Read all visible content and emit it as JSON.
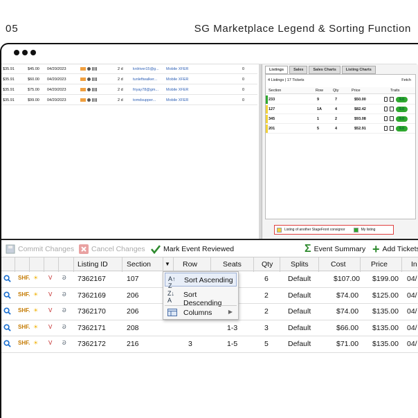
{
  "page": {
    "number": "05",
    "title": "SG Marketplace Legend & Sorting Function"
  },
  "left_rows": [
    {
      "cost": "$35.91",
      "price": "$45.00",
      "date": "04/20/2023",
      "days": "2 d",
      "email": "krdriver15@g...",
      "delivery": "Mobile XFER",
      "count": "0"
    },
    {
      "cost": "$35.91",
      "price": "$60.00",
      "date": "04/20/2023",
      "days": "2 d",
      "email": "tunleftwalker...",
      "delivery": "Mobile XFER",
      "count": "0"
    },
    {
      "cost": "$35.91",
      "price": "$75.00",
      "date": "04/20/2023",
      "days": "2 d",
      "email": "friyay78@gm...",
      "delivery": "Mobile XFER",
      "count": "0"
    },
    {
      "cost": "$35.91",
      "price": "$99.00",
      "date": "04/20/2023",
      "days": "2 d",
      "email": "tomdsupper...",
      "delivery": "Mobile XFER",
      "count": "0"
    }
  ],
  "right_panel": {
    "tabs": [
      "Listings",
      "Sales",
      "Sales Charts",
      "Listing Charts"
    ],
    "count_label": "4 Listings | 17 Tickets",
    "fetch_label": "Fetch",
    "headers": {
      "section": "Section",
      "row": "Row",
      "qty": "Qty",
      "price": "Price",
      "traits": "Traits"
    },
    "rows": [
      {
        "section": "233",
        "row": "9",
        "qty": "7",
        "price": "$50.00",
        "pill": "9.0",
        "bar": "#2fa82f"
      },
      {
        "section": "127",
        "row": "1A",
        "qty": "4",
        "price": "$82.42",
        "pill": "9.0",
        "bar": "#f2d23a"
      },
      {
        "section": "345",
        "row": "1",
        "qty": "2",
        "price": "$93.08",
        "pill": "9.0",
        "bar": "#f2d23a"
      },
      {
        "section": "201",
        "row": "5",
        "qty": "4",
        "price": "$52.91",
        "pill": "9.0",
        "bar": "#f2d23a"
      }
    ],
    "legend": {
      "other": "Listing of another StageFront consignor",
      "mine": "My listing",
      "other_color": "#f2d23a",
      "mine_color": "#2fa82f"
    }
  },
  "toolbar": {
    "commit": "Commit Changes",
    "cancel": "Cancel Changes",
    "mark": "Mark Event Reviewed",
    "summary": "Event Summary",
    "add": "Add Tickets"
  },
  "grid": {
    "headers": {
      "listing_id": "Listing ID",
      "section": "Section",
      "row": "Row",
      "seats": "Seats",
      "qty": "Qty",
      "splits": "Splits",
      "cost": "Cost",
      "price": "Price",
      "in": "In"
    },
    "rows": [
      {
        "listing_id": "7362167",
        "section": "107",
        "row": "",
        "seats": "",
        "qty": "6",
        "splits": "Default",
        "cost": "$107.00",
        "price": "$199.00",
        "date": "04/"
      },
      {
        "listing_id": "7362169",
        "section": "206",
        "row": "",
        "seats": "",
        "qty": "2",
        "splits": "Default",
        "cost": "$74.00",
        "price": "$125.00",
        "date": "04/"
      },
      {
        "listing_id": "7362170",
        "section": "206",
        "row": "",
        "seats": "",
        "qty": "2",
        "splits": "Default",
        "cost": "$74.00",
        "price": "$135.00",
        "date": "04/"
      },
      {
        "listing_id": "7362171",
        "section": "208",
        "row": "",
        "seats": "1-3",
        "qty": "3",
        "splits": "Default",
        "cost": "$66.00",
        "price": "$135.00",
        "date": "04/"
      },
      {
        "listing_id": "7362172",
        "section": "216",
        "row": "3",
        "seats": "1-5",
        "qty": "5",
        "splits": "Default",
        "cost": "$71.00",
        "price": "$135.00",
        "date": "04/"
      }
    ]
  },
  "context_menu": {
    "asc": "Sort Ascending",
    "desc": "Sort Descending",
    "columns": "Columns"
  }
}
